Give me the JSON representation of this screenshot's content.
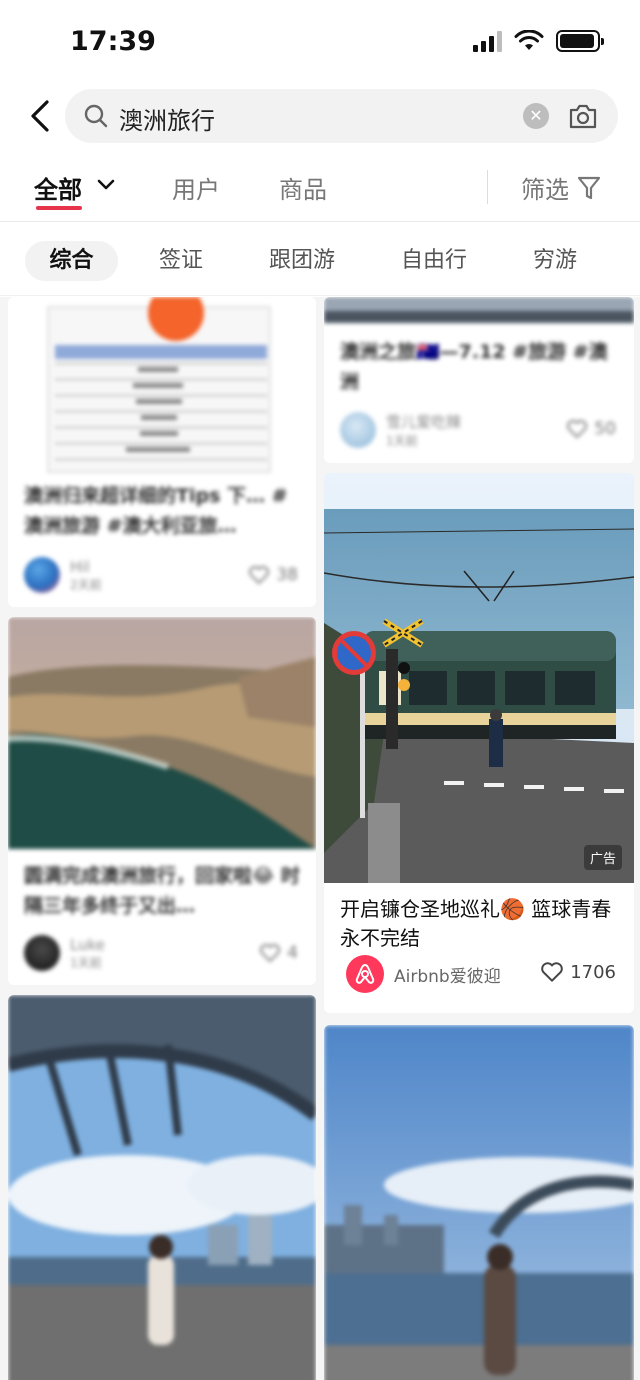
{
  "status": {
    "time": "17:39"
  },
  "search": {
    "query": "澳洲旅行"
  },
  "tabs": [
    {
      "label": "全部"
    },
    {
      "label": "用户"
    },
    {
      "label": "商品"
    }
  ],
  "filter": {
    "label": "筛选"
  },
  "subtabs": [
    {
      "label": "综合"
    },
    {
      "label": "签证"
    },
    {
      "label": "跟团游"
    },
    {
      "label": "自由行"
    },
    {
      "label": "穷游"
    }
  ],
  "feed": {
    "card1": {
      "title": "澳洲归来超详细的Tips 下… #澳洲旅游 #澳大利亚旅…",
      "author": "Hil",
      "date": "2天前",
      "likes": "38"
    },
    "card2": {
      "title": "澳洲之旅🇦🇺—7.12 #旅游 #澳洲",
      "author": "雪儿爱吃辣",
      "date": "1天前",
      "likes": "50"
    },
    "card3": {
      "title": "圆满完成澳洲旅行，回家啦😂 时隔三年多终于又出…",
      "author": "Luke",
      "date": "1天前",
      "likes": "4"
    },
    "ad": {
      "title": "开启镰仓圣地巡礼🏀 篮球青春永不完结",
      "badge": "广告",
      "author": "Airbnb爱彼迎",
      "likes": "1706"
    }
  },
  "colors": {
    "accent": "#e8344a",
    "airbnb": "#ff385c"
  }
}
